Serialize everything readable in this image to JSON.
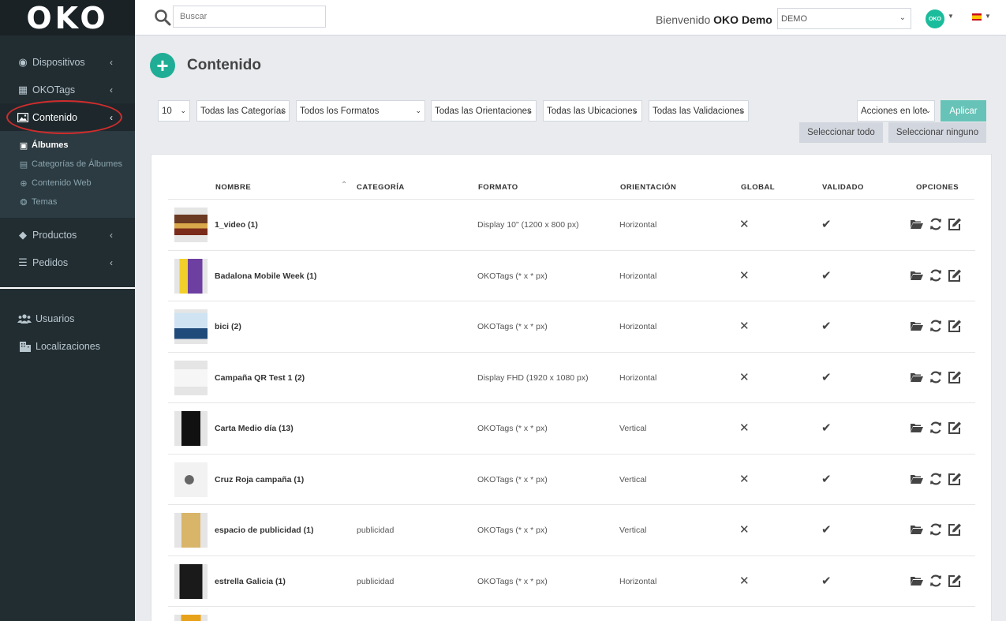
{
  "sidebar": {
    "logo": "OKO",
    "nav": [
      {
        "label": "Dispositivos",
        "icon": "dot-circle-icon"
      },
      {
        "label": "OKOTags",
        "icon": "qrcode-icon"
      },
      {
        "label": "Contenido",
        "icon": "image-icon",
        "active": true
      }
    ],
    "subnav": [
      {
        "label": "Álbumes",
        "icon": "image-icon"
      },
      {
        "label": "Categorías de Álbumes",
        "icon": "list-icon"
      },
      {
        "label": "Contenido Web",
        "icon": "globe-icon"
      },
      {
        "label": "Temas",
        "icon": "palette-icon"
      }
    ],
    "nav_lower": [
      {
        "label": "Productos",
        "icon": "cube-icon"
      },
      {
        "label": "Pedidos",
        "icon": "list-ul-icon"
      }
    ],
    "nav_bottom": [
      {
        "label": "Usuarios",
        "icon": "users-icon"
      },
      {
        "label": "Localizaciones",
        "icon": "building-icon"
      }
    ]
  },
  "header": {
    "search_placeholder": "Buscar",
    "welcome_prefix": "Bienvenido",
    "welcome_user": "OKO Demo",
    "company": "DEMO",
    "avatar_text": "OKO"
  },
  "page": {
    "title": "Contenido"
  },
  "filters": {
    "page_size": "10",
    "categories": "Todas las Categorías",
    "formats": "Todos los Formatos",
    "orientations": "Todas las Orientaciones",
    "locations": "Todas las Ubicaciones",
    "validations": "Todas las Validaciones",
    "bulk_actions": "Acciones en lote",
    "apply": "Aplicar",
    "select_all": "Seleccionar todo",
    "select_none": "Seleccionar ninguno"
  },
  "table": {
    "columns": {
      "name": "NOMBRE",
      "category": "CATEGORÍA",
      "format": "FORMATO",
      "orientation": "ORIENTACIÓN",
      "global": "GLOBAL",
      "validated": "VALIDADO",
      "options": "OPCIONES"
    },
    "rows": [
      {
        "name": "1_video (1)",
        "category": "",
        "format": "Display 10\" (1200 x 800 px)",
        "orientation": "Horizontal"
      },
      {
        "name": "Badalona Mobile Week (1)",
        "category": "",
        "format": "OKOTags (* x * px)",
        "orientation": "Horizontal"
      },
      {
        "name": "bici (2)",
        "category": "",
        "format": "OKOTags (* x * px)",
        "orientation": "Horizontal"
      },
      {
        "name": "Campaña QR Test 1 (2)",
        "category": "",
        "format": "Display FHD (1920 x 1080 px)",
        "orientation": "Horizontal"
      },
      {
        "name": "Carta Medio día (13)",
        "category": "",
        "format": "OKOTags (* x * px)",
        "orientation": "Vertical"
      },
      {
        "name": "Cruz Roja campaña (1)",
        "category": "",
        "format": "OKOTags (* x * px)",
        "orientation": "Vertical"
      },
      {
        "name": "espacio de publicidad (1)",
        "category": "publicidad",
        "format": "OKOTags (* x * px)",
        "orientation": "Vertical"
      },
      {
        "name": "estrella Galicia (1)",
        "category": "publicidad",
        "format": "OKOTags (* x * px)",
        "orientation": "Horizontal"
      }
    ]
  },
  "colors": {
    "sidebar_bg": "#222d32",
    "accent": "#1fad96",
    "apply_btn": "#67c3b7",
    "highlight_ring": "#d12c2c"
  }
}
